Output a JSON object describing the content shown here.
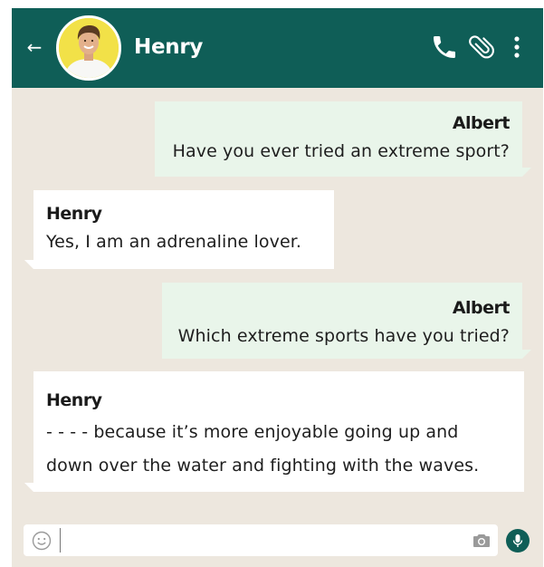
{
  "header": {
    "contact_name": "Henry",
    "back_icon": "back-arrow-icon",
    "actions": [
      "phone-icon",
      "paperclip-icon",
      "menu-dots-icon"
    ],
    "background_color": "#0f5e57"
  },
  "chat": {
    "background_color": "#ede7de",
    "outgoing_color": "#e9f5ea",
    "incoming_color": "#ffffff",
    "messages": [
      {
        "sender": "Albert",
        "direction": "outgoing",
        "lines": [
          "Have you ever tried an extreme sport?"
        ]
      },
      {
        "sender": "Henry",
        "direction": "incoming",
        "lines": [
          "Yes, I am an adrenaline lover."
        ]
      },
      {
        "sender": "Albert",
        "direction": "outgoing",
        "lines": [
          "Which extreme sports have you tried?"
        ]
      },
      {
        "sender": "Henry",
        "direction": "incoming",
        "lines": [
          "- - - - because it’s more enjoyable going up and",
          "down over the water and fighting with the waves."
        ]
      }
    ]
  },
  "composer": {
    "value": "",
    "placeholder": "",
    "emoji_icon": "emoji-icon",
    "camera_icon": "camera-icon",
    "mic_icon": "mic-icon"
  }
}
